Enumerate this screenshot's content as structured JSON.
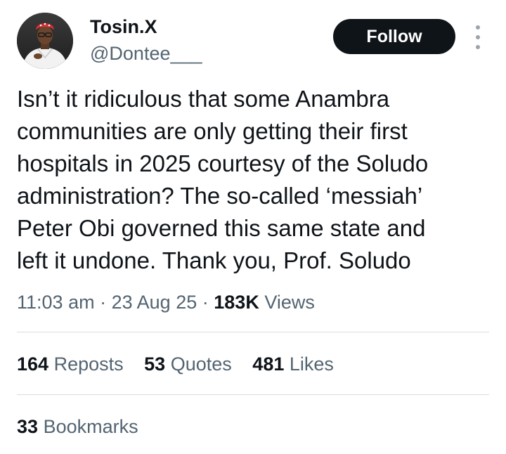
{
  "user": {
    "display_name": "Tosin.X",
    "handle": "@Dontee___"
  },
  "actions": {
    "follow_label": "Follow",
    "more_icon": "more-vertical-icon"
  },
  "tweet": {
    "text": "Isn’t it ridiculous that some Anambra\ncommunities are only getting their first\nhospitals in 2025 courtesy of the Soludo\nadministration? The so-called ‘messiah’\nPeter Obi governed this same state and\nleft it undone. Thank you, Prof. Soludo"
  },
  "meta": {
    "time": "11:03 am",
    "separator": "·",
    "date": "23 Aug 25",
    "views_count": "183K",
    "views_label": "Views"
  },
  "stats": {
    "reposts_count": "164",
    "reposts_label": "Reposts",
    "quotes_count": "53",
    "quotes_label": "Quotes",
    "likes_count": "481",
    "likes_label": "Likes",
    "bookmarks_count": "33",
    "bookmarks_label": "Bookmarks"
  },
  "colors": {
    "text_primary": "#0f1419",
    "text_secondary": "#536471",
    "button_bg": "#0f1419",
    "divider": "#d8dee3"
  }
}
